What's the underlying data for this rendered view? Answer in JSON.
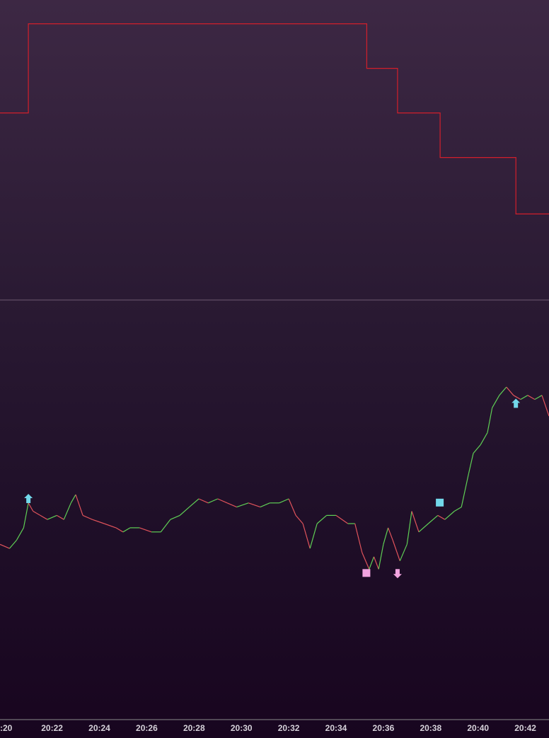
{
  "chart_data": [
    {
      "panel": "upper",
      "type": "line",
      "interpolation": "step",
      "x_range_minutes": [
        1219.8,
        1243.0
      ],
      "ylim": [
        0,
        100
      ],
      "series": [
        {
          "color": "#d11f2b",
          "points": [
            {
              "x": 1219.8,
              "y": 62
            },
            {
              "x": 1221.0,
              "y": 62
            },
            {
              "x": 1221.0,
              "y": 92
            },
            {
              "x": 1235.3,
              "y": 92
            },
            {
              "x": 1235.3,
              "y": 77
            },
            {
              "x": 1236.6,
              "y": 77
            },
            {
              "x": 1236.6,
              "y": 62
            },
            {
              "x": 1238.4,
              "y": 62
            },
            {
              "x": 1238.4,
              "y": 47
            },
            {
              "x": 1241.6,
              "y": 47
            },
            {
              "x": 1241.6,
              "y": 28
            },
            {
              "x": 1243.0,
              "y": 28
            }
          ]
        }
      ]
    },
    {
      "panel": "lower",
      "type": "line",
      "x_range_minutes": [
        1219.8,
        1243.0
      ],
      "ylim": [
        0,
        100
      ],
      "colors": {
        "up": "#5fcf55",
        "down": "#e0535b"
      },
      "series": [
        {
          "points": [
            {
              "x": 1219.8,
              "y": 42
            },
            {
              "x": 1220.2,
              "y": 41
            },
            {
              "x": 1220.5,
              "y": 43
            },
            {
              "x": 1220.8,
              "y": 46
            },
            {
              "x": 1221.0,
              "y": 52
            },
            {
              "x": 1221.2,
              "y": 50
            },
            {
              "x": 1221.5,
              "y": 49
            },
            {
              "x": 1221.8,
              "y": 48
            },
            {
              "x": 1222.2,
              "y": 49
            },
            {
              "x": 1222.5,
              "y": 48
            },
            {
              "x": 1222.8,
              "y": 52
            },
            {
              "x": 1223.0,
              "y": 54
            },
            {
              "x": 1223.3,
              "y": 49
            },
            {
              "x": 1223.7,
              "y": 48
            },
            {
              "x": 1224.2,
              "y": 47
            },
            {
              "x": 1224.7,
              "y": 46
            },
            {
              "x": 1225.0,
              "y": 45
            },
            {
              "x": 1225.3,
              "y": 46
            },
            {
              "x": 1225.7,
              "y": 46
            },
            {
              "x": 1226.2,
              "y": 45
            },
            {
              "x": 1226.6,
              "y": 45
            },
            {
              "x": 1227.0,
              "y": 48
            },
            {
              "x": 1227.4,
              "y": 49
            },
            {
              "x": 1227.8,
              "y": 51
            },
            {
              "x": 1228.2,
              "y": 53
            },
            {
              "x": 1228.6,
              "y": 52
            },
            {
              "x": 1229.0,
              "y": 53
            },
            {
              "x": 1229.4,
              "y": 52
            },
            {
              "x": 1229.8,
              "y": 51
            },
            {
              "x": 1230.3,
              "y": 52
            },
            {
              "x": 1230.8,
              "y": 51
            },
            {
              "x": 1231.2,
              "y": 52
            },
            {
              "x": 1231.6,
              "y": 52
            },
            {
              "x": 1232.0,
              "y": 53
            },
            {
              "x": 1232.3,
              "y": 49
            },
            {
              "x": 1232.6,
              "y": 47
            },
            {
              "x": 1232.9,
              "y": 41
            },
            {
              "x": 1233.2,
              "y": 47
            },
            {
              "x": 1233.6,
              "y": 49
            },
            {
              "x": 1234.0,
              "y": 49
            },
            {
              "x": 1234.5,
              "y": 47
            },
            {
              "x": 1234.8,
              "y": 47
            },
            {
              "x": 1235.1,
              "y": 40
            },
            {
              "x": 1235.4,
              "y": 36
            },
            {
              "x": 1235.6,
              "y": 39
            },
            {
              "x": 1235.8,
              "y": 36
            },
            {
              "x": 1236.0,
              "y": 42
            },
            {
              "x": 1236.2,
              "y": 46
            },
            {
              "x": 1236.4,
              "y": 43
            },
            {
              "x": 1236.7,
              "y": 38
            },
            {
              "x": 1237.0,
              "y": 42
            },
            {
              "x": 1237.2,
              "y": 50
            },
            {
              "x": 1237.5,
              "y": 45
            },
            {
              "x": 1237.9,
              "y": 47
            },
            {
              "x": 1238.3,
              "y": 49
            },
            {
              "x": 1238.6,
              "y": 48
            },
            {
              "x": 1239.0,
              "y": 50
            },
            {
              "x": 1239.3,
              "y": 51
            },
            {
              "x": 1239.6,
              "y": 59
            },
            {
              "x": 1239.8,
              "y": 64
            },
            {
              "x": 1240.1,
              "y": 66
            },
            {
              "x": 1240.4,
              "y": 69
            },
            {
              "x": 1240.6,
              "y": 75
            },
            {
              "x": 1240.9,
              "y": 78
            },
            {
              "x": 1241.2,
              "y": 80
            },
            {
              "x": 1241.5,
              "y": 78
            },
            {
              "x": 1241.8,
              "y": 77
            },
            {
              "x": 1242.1,
              "y": 78
            },
            {
              "x": 1242.4,
              "y": 77
            },
            {
              "x": 1242.7,
              "y": 78
            },
            {
              "x": 1243.0,
              "y": 73
            }
          ]
        }
      ],
      "markers": [
        {
          "shape": "arrow-up",
          "color": "#72d8ea",
          "x": 1221.0,
          "y": 53
        },
        {
          "shape": "square",
          "color": "#f2a4e0",
          "x": 1235.3,
          "y": 35
        },
        {
          "shape": "arrow-down",
          "color": "#f2a4e0",
          "x": 1236.6,
          "y": 35
        },
        {
          "shape": "square",
          "color": "#72d8ea",
          "x": 1238.4,
          "y": 52
        },
        {
          "shape": "arrow-up",
          "color": "#72d8ea",
          "x": 1241.6,
          "y": 76
        }
      ]
    }
  ],
  "x_axis": {
    "ticks": [
      {
        "value": 1220,
        "label": ":20"
      },
      {
        "value": 1222,
        "label": "20:22"
      },
      {
        "value": 1224,
        "label": "20:24"
      },
      {
        "value": 1226,
        "label": "20:26"
      },
      {
        "value": 1228,
        "label": "20:28"
      },
      {
        "value": 1230,
        "label": "20:30"
      },
      {
        "value": 1232,
        "label": "20:32"
      },
      {
        "value": 1234,
        "label": "20:34"
      },
      {
        "value": 1236,
        "label": "20:36"
      },
      {
        "value": 1238,
        "label": "20:38"
      },
      {
        "value": 1240,
        "label": "20:40"
      },
      {
        "value": 1242,
        "label": "20:42"
      }
    ]
  },
  "colors": {
    "divider": "#6e5a70",
    "axis_bottom": "#8a8a8a",
    "tick_text": "#d6d2da"
  }
}
